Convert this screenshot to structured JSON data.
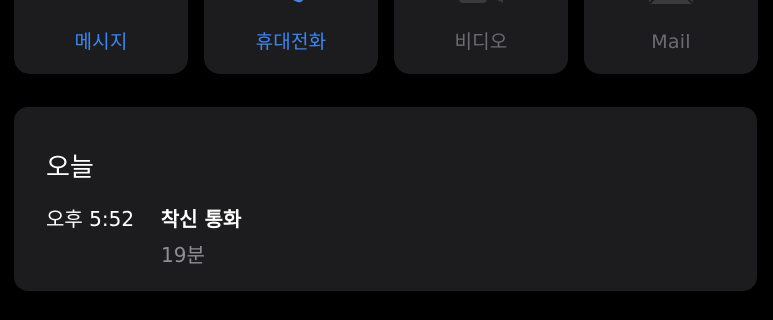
{
  "actions": [
    {
      "id": "message",
      "label": "메시지",
      "icon": "message-bubble-icon",
      "enabled": true
    },
    {
      "id": "mobile",
      "label": "휴대전화",
      "icon": "phone-icon",
      "enabled": true
    },
    {
      "id": "video",
      "label": "비디오",
      "icon": "video-camera-icon",
      "enabled": false
    },
    {
      "id": "mail",
      "label": "Mail",
      "icon": "envelope-icon",
      "enabled": false
    }
  ],
  "colors": {
    "background": "#000000",
    "card": "#1c1c1e",
    "accent": "#3a86f4",
    "disabled": "#6c6c70",
    "secondary_text": "#8e8e93"
  },
  "recents": {
    "title": "오늘",
    "calls": [
      {
        "time": "오후 5:52",
        "type": "착신 통화",
        "duration": "19분"
      }
    ]
  }
}
